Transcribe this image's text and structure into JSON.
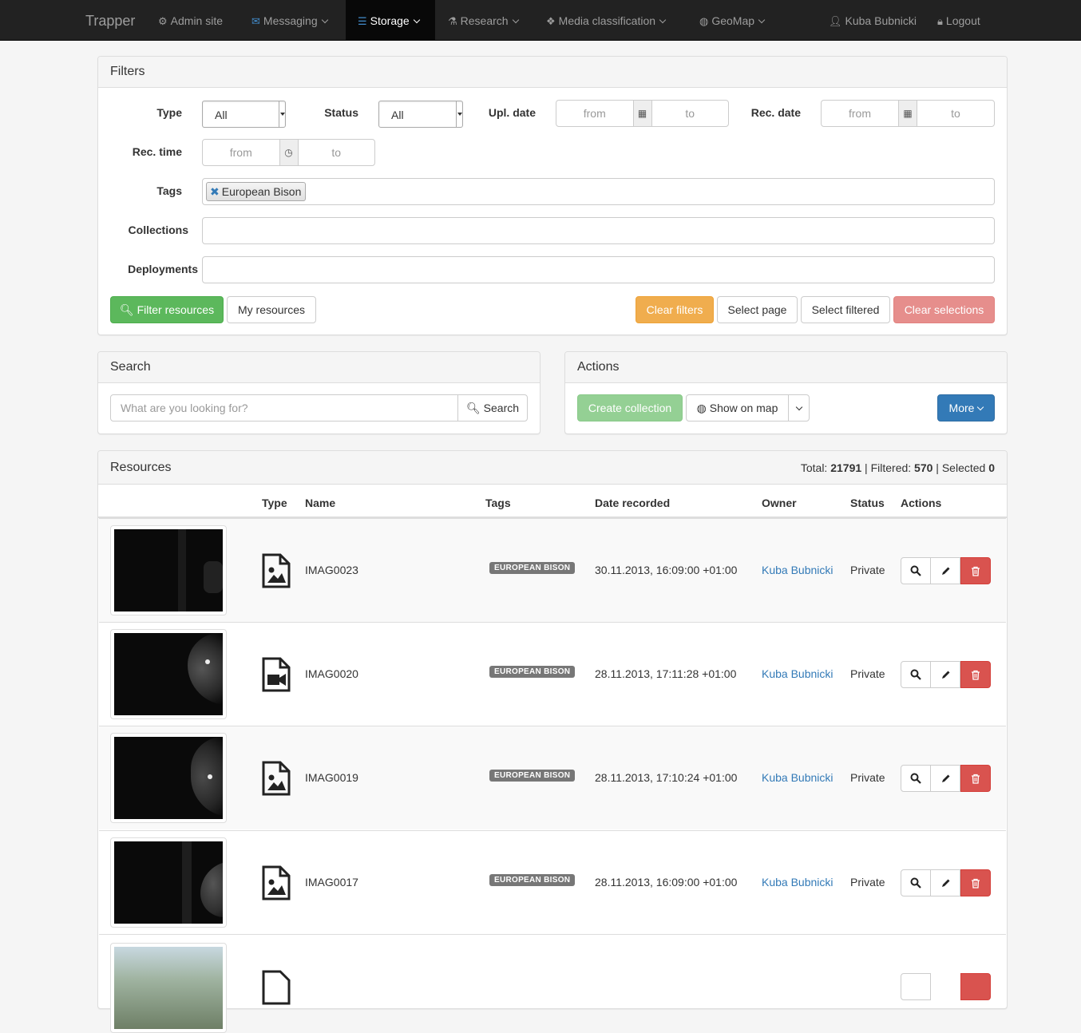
{
  "nav": {
    "brand": "Trapper",
    "items": [
      {
        "label": "Admin site",
        "icon": "gears-icon"
      },
      {
        "label": "Messaging",
        "icon": "envelope-icon"
      },
      {
        "label": "Storage",
        "icon": "database-icon"
      },
      {
        "label": "Research",
        "icon": "flask-icon"
      },
      {
        "label": "Media classification",
        "icon": "cubes-icon"
      },
      {
        "label": "GeoMap",
        "icon": "globe-icon"
      }
    ],
    "user": "Kuba Bubnicki",
    "logout": "Logout"
  },
  "filters": {
    "title": "Filters",
    "type_label": "Type",
    "type_value": "All",
    "status_label": "Status",
    "status_value": "All",
    "upl_label": "Upl. date",
    "rec_date_label": "Rec. date",
    "rec_time_label": "Rec. time",
    "from": "from",
    "to": "to",
    "tags_label": "Tags",
    "tag_selected": "European Bison",
    "collections_label": "Collections",
    "deployments_label": "Deployments",
    "filter_btn": "Filter resources",
    "my_resources_btn": "My resources",
    "clear_filters_btn": "Clear filters",
    "select_page_btn": "Select page",
    "select_filtered_btn": "Select filtered",
    "clear_selections_btn": "Clear selections"
  },
  "search": {
    "title": "Search",
    "placeholder": "What are you looking for?",
    "button": "Search"
  },
  "actions": {
    "title": "Actions",
    "create_collection": "Create collection",
    "show_on_map": "Show on map",
    "more": "More"
  },
  "resources": {
    "title": "Resources",
    "total_label": "Total:",
    "total": "21791",
    "filtered_label": "Filtered:",
    "filtered": "570",
    "selected_label": "Selected",
    "selected": "0",
    "sep": "|",
    "columns": [
      "Type",
      "Name",
      "Tags",
      "Date recorded",
      "Owner",
      "Status",
      "Actions"
    ],
    "rows": [
      {
        "type": "image",
        "name": "IMAG0023",
        "tag": "EUROPEAN BISON",
        "date": "30.11.2013, 16:09:00 +01:00",
        "owner": "Kuba Bubnicki",
        "status": "Private"
      },
      {
        "type": "video",
        "name": "IMAG0020",
        "tag": "EUROPEAN BISON",
        "date": "28.11.2013, 17:11:28 +01:00",
        "owner": "Kuba Bubnicki",
        "status": "Private"
      },
      {
        "type": "image",
        "name": "IMAG0019",
        "tag": "EUROPEAN BISON",
        "date": "28.11.2013, 17:10:24 +01:00",
        "owner": "Kuba Bubnicki",
        "status": "Private"
      },
      {
        "type": "image",
        "name": "IMAG0017",
        "tag": "EUROPEAN BISON",
        "date": "28.11.2013, 16:09:00 +01:00",
        "owner": "Kuba Bubnicki",
        "status": "Private"
      }
    ]
  }
}
